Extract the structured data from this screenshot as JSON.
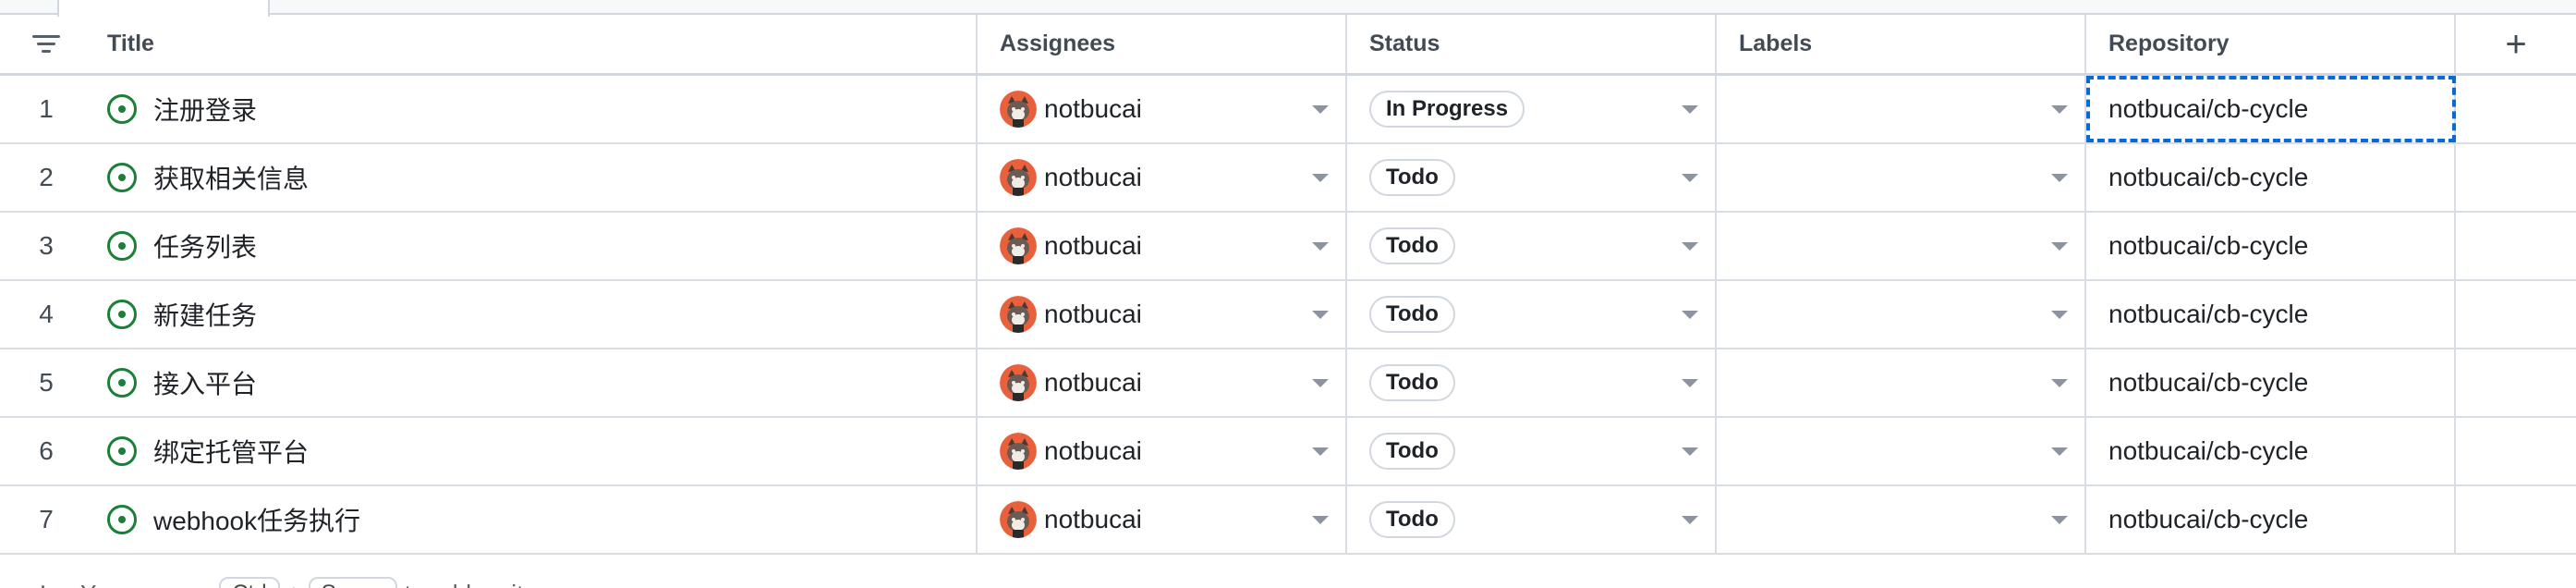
{
  "table": {
    "columns": {
      "title": "Title",
      "assignees": "Assignees",
      "status": "Status",
      "labels": "Labels",
      "repository": "Repository",
      "add": "+"
    },
    "rows": [
      {
        "num": "1",
        "title": "注册登录",
        "assignee": "notbucai",
        "status": "In Progress",
        "labels": "",
        "repository": "notbucai/cb-cycle"
      },
      {
        "num": "2",
        "title": "获取相关信息",
        "assignee": "notbucai",
        "status": "Todo",
        "labels": "",
        "repository": "notbucai/cb-cycle"
      },
      {
        "num": "3",
        "title": "任务列表",
        "assignee": "notbucai",
        "status": "Todo",
        "labels": "",
        "repository": "notbucai/cb-cycle"
      },
      {
        "num": "4",
        "title": "新建任务",
        "assignee": "notbucai",
        "status": "Todo",
        "labels": "",
        "repository": "notbucai/cb-cycle"
      },
      {
        "num": "5",
        "title": "接入平台",
        "assignee": "notbucai",
        "status": "Todo",
        "labels": "",
        "repository": "notbucai/cb-cycle"
      },
      {
        "num": "6",
        "title": "绑定托管平台",
        "assignee": "notbucai",
        "status": "Todo",
        "labels": "",
        "repository": "notbucai/cb-cycle"
      },
      {
        "num": "7",
        "title": "webhook任务执行",
        "assignee": "notbucai",
        "status": "Todo",
        "labels": "",
        "repository": "notbucai/cb-cycle"
      }
    ]
  },
  "footer": {
    "plus": "+",
    "hint_prefix": "You can use",
    "key1": "Ctrl",
    "plus_sep": "+",
    "key2": "Space",
    "hint_suffix": "to add an item"
  },
  "colors": {
    "issue_open": "#1a7f37",
    "focus_outline": "#0969da",
    "border": "#d0d7de"
  },
  "icons": {
    "filter": "filter-icon",
    "issue": "issue-opened-icon",
    "caret": "chevron-down-icon",
    "add": "plus-icon"
  }
}
